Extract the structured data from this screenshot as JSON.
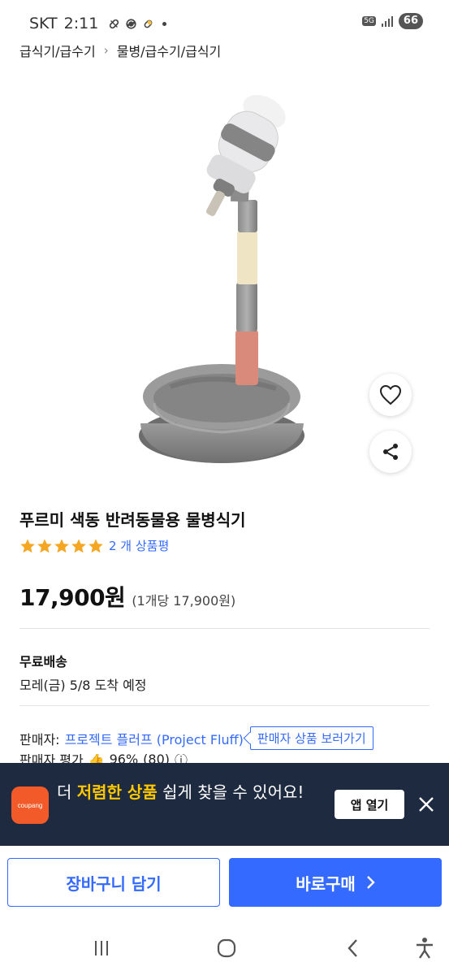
{
  "status_bar": {
    "carrier": "SKT",
    "time": "2:11",
    "network_badge": "5G",
    "battery": "66"
  },
  "breadcrumb": {
    "items": [
      "급식기/급수기",
      "물병/급수기/급식기"
    ]
  },
  "product": {
    "title": "푸르미 색동 반려동물용 물병식기",
    "rating_stars": 5,
    "review_count_text": "2 개 상품평",
    "price": "17,900원",
    "unit_price": "(1개당 17,900원)"
  },
  "shipping": {
    "title": "무료배송",
    "eta": "모레(금) 5/8 도착 예정"
  },
  "seller": {
    "label": "판매자:",
    "name": "프로젝트 플러프 (Project Fluff)",
    "view_products_label": "판매자 상품 보러가기",
    "rating_label": "판매자 평가",
    "rating_value": "96%",
    "rating_count": "(80)"
  },
  "app_banner": {
    "text_prefix": "더 ",
    "text_highlight": "저렴한 상품",
    "text_suffix": " 쉽게 찾을 수 있어요!",
    "logo_text": "coupang",
    "open_app_label": "앱 열기"
  },
  "actions": {
    "cart_label": "장바구니 담기",
    "buy_label": "바로구매"
  },
  "colors": {
    "accent": "#346aff",
    "star": "#f5a623",
    "banner_bg": "#1d2a3f",
    "banner_highlight": "#ffc800",
    "logo": "#f25b29"
  },
  "icons": {
    "like": "heart-icon",
    "share": "share-icon",
    "close": "close-icon",
    "chevron": "chevron-right-icon",
    "nav_recent": "recent-apps-icon",
    "nav_home": "home-icon",
    "nav_back": "back-icon",
    "nav_accessibility": "accessibility-icon"
  }
}
